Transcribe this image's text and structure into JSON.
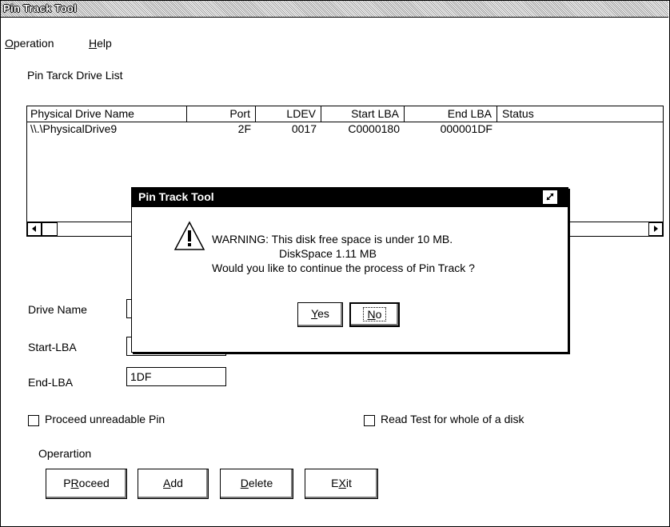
{
  "window": {
    "title": "Pin Track Tool"
  },
  "menu": [
    {
      "label": "Operation",
      "mnemonic": "O",
      "rest": "peration"
    },
    {
      "label": "Help",
      "mnemonic": "H",
      "rest": "elp"
    }
  ],
  "drive_list": {
    "label": "Pin Tarck Drive List",
    "columns": [
      "Physical Drive Name",
      "Port",
      "LDEV",
      "Start LBA",
      "End LBA",
      "Status"
    ],
    "rows": [
      {
        "physical_drive_name": "\\\\.\\PhysicalDrive9",
        "port": "2F",
        "ldev": "0017",
        "start_lba": "C0000180",
        "end_lba": "000001DF",
        "status": ""
      }
    ]
  },
  "fields": {
    "drive_name": {
      "label": "Drive Name",
      "value": ""
    },
    "start_lba": {
      "label": "Start-LBA",
      "value": ""
    },
    "end_lba": {
      "label": "End-LBA",
      "value": "1DF"
    }
  },
  "checkboxes": [
    {
      "label": "Proceed unreadable Pin",
      "checked": false
    },
    {
      "label": "Read Test for whole of a disk",
      "checked": false
    }
  ],
  "operation_group": {
    "label": "Operartion",
    "buttons": [
      {
        "pre": "P",
        "mnemonic": "R",
        "post": "oceed"
      },
      {
        "pre": "",
        "mnemonic": "A",
        "post": "dd"
      },
      {
        "pre": "",
        "mnemonic": "D",
        "post": "elete"
      },
      {
        "pre": "E",
        "mnemonic": "X",
        "post": "it"
      }
    ]
  },
  "dialog": {
    "title": "Pin Track Tool",
    "icon": "warning-icon",
    "line1": "WARNING: This disk free space is under 10 MB.",
    "line2": "DiskSpace 1.11 MB",
    "line3": "Would you like to continue the process of Pin Track ?",
    "yes": {
      "mnemonic": "Y",
      "rest": "es"
    },
    "no": {
      "mnemonic": "N",
      "rest": "o"
    }
  }
}
